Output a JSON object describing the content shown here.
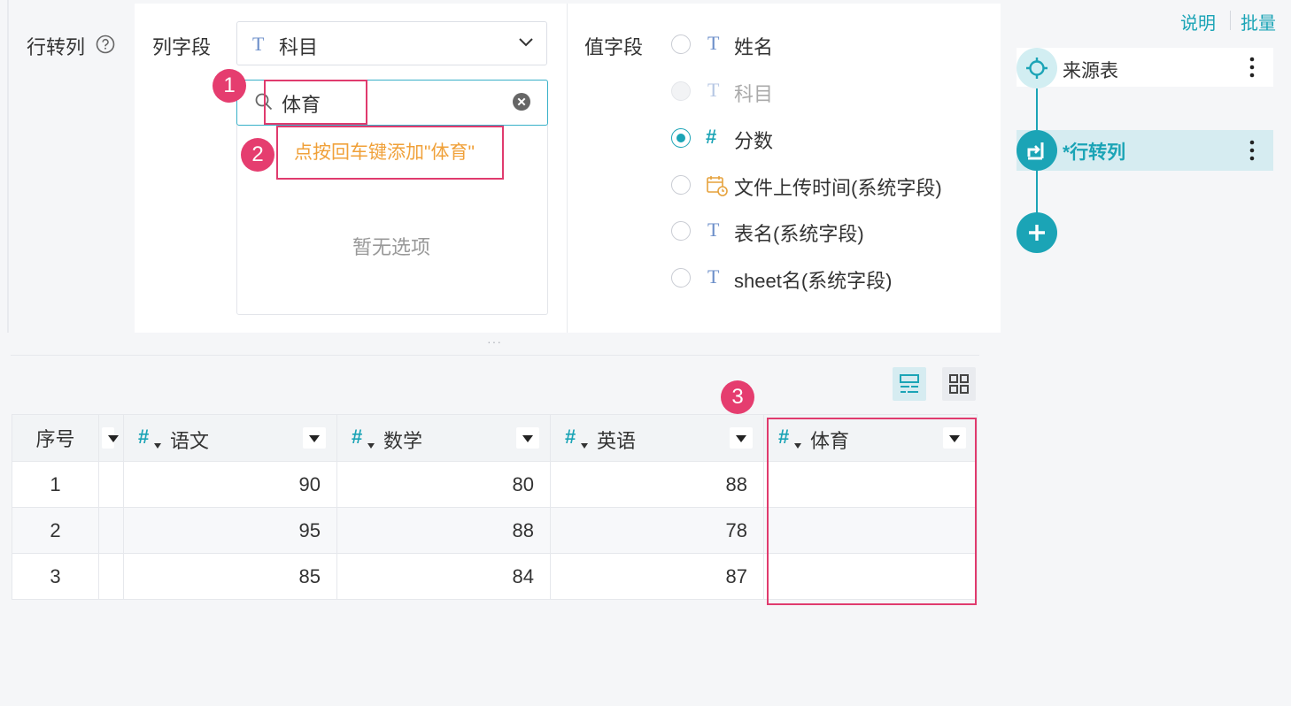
{
  "config": {
    "section_label": "行转列",
    "column_field": {
      "label": "列字段",
      "selected_value": "科目",
      "search_value": "体育",
      "add_hint": "点按回车键添加\"体育\"",
      "empty_text": "暂无选项"
    },
    "value_field": {
      "label": "值字段",
      "options": [
        {
          "type": "text",
          "label": "姓名",
          "state": "unchecked"
        },
        {
          "type": "text",
          "label": "科目",
          "state": "disabled"
        },
        {
          "type": "number",
          "label": "分数",
          "state": "checked"
        },
        {
          "type": "date",
          "label": "文件上传时间(系统字段)",
          "state": "unchecked"
        },
        {
          "type": "text",
          "label": "表名(系统字段)",
          "state": "unchecked"
        },
        {
          "type": "text",
          "label": "sheet名(系统字段)",
          "state": "unchecked"
        }
      ]
    }
  },
  "annotations": {
    "badge1": "1",
    "badge2": "2",
    "badge3": "3",
    "highlight_color": "#e03b6e"
  },
  "right_panel": {
    "links": {
      "explain": "说明",
      "batch": "批量"
    },
    "steps": [
      {
        "label": "来源表",
        "state": "normal"
      },
      {
        "label": "*行转列",
        "state": "active"
      }
    ]
  },
  "table": {
    "columns": [
      {
        "label": "序号",
        "type": "seq"
      },
      {
        "label": "",
        "type": "collapsed"
      },
      {
        "label": "语文",
        "type": "number"
      },
      {
        "label": "数学",
        "type": "number"
      },
      {
        "label": "英语",
        "type": "number"
      },
      {
        "label": "体育",
        "type": "number"
      }
    ],
    "rows": [
      [
        "1",
        "",
        "90",
        "80",
        "88",
        ""
      ],
      [
        "2",
        "",
        "95",
        "88",
        "78",
        ""
      ],
      [
        "3",
        "",
        "85",
        "84",
        "87",
        ""
      ]
    ]
  },
  "colors": {
    "accent": "#1ba4b6",
    "warning": "#f0a13a",
    "badge": "#e53d6f"
  },
  "icons": [
    "help-icon",
    "text-type-icon",
    "chevron-down-icon",
    "search-icon",
    "clear-icon",
    "number-type-icon",
    "date-type-icon",
    "source-target-icon",
    "row-to-col-icon",
    "more-icon",
    "plus-icon",
    "list-view-icon",
    "grid-view-icon",
    "dropdown-caret-icon"
  ]
}
